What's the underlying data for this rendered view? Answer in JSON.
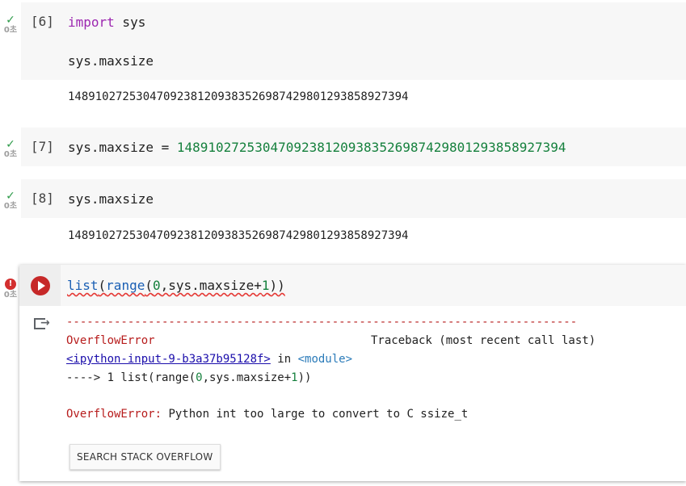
{
  "cells": [
    {
      "prompt": "[6]",
      "check": "✓",
      "time": "0초",
      "code_line1_kw": "import",
      "code_line1_rest": " sys",
      "code_line2": "sys.maxsize",
      "output": "14891027253047092381209383526987429801293858927394"
    },
    {
      "prompt": "[7]",
      "check": "✓",
      "time": "0초",
      "code_lhs": "sys.maxsize = ",
      "code_rhs": "14891027253047092381209383526987429801293858927394"
    },
    {
      "prompt": "[8]",
      "check": "✓",
      "time": "0초",
      "code": "sys.maxsize",
      "output": "14891027253047092381209383526987429801293858927394"
    },
    {
      "error_mark": "!",
      "time": "0초",
      "code_fn1": "list",
      "code_p1": "(",
      "code_fn2": "range",
      "code_p2": "(",
      "code_num1": "0",
      "code_mid": ",sys.maxsize+",
      "code_num2": "1",
      "code_end": "))",
      "traceback": {
        "dashes": "---------------------------------------------------------------------------",
        "err_name": "OverflowError",
        "traceback_header": "Traceback (most recent call last)",
        "input_link": "<ipython-input-9-b3a37b95128f>",
        "in_word": " in ",
        "module": "<module>",
        "arrow_line_prefix": "----> 1 list(range(",
        "arrow_num": "0",
        "arrow_mid": ",sys.maxsize+",
        "arrow_num2": "1",
        "arrow_end": "))",
        "final_err_name": "OverflowError:",
        "final_msg": " Python int too large to convert to C ssize_t"
      },
      "search_button": "SEARCH STACK OVERFLOW"
    }
  ],
  "colors": {
    "accent_red": "#c62828",
    "check_green": "#2e9b4a"
  }
}
